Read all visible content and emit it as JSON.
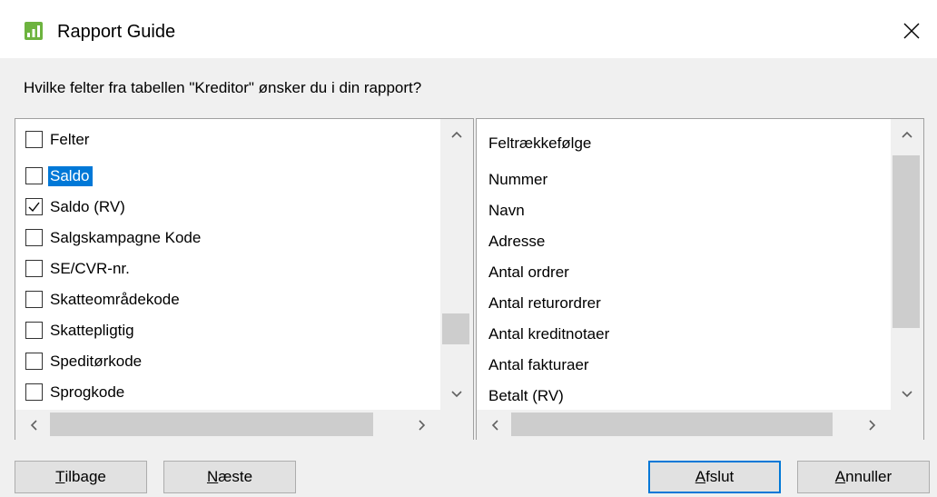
{
  "window": {
    "title": "Rapport Guide",
    "icon": "bar-chart-icon"
  },
  "question": "Hvilke felter fra tabellen \"Kreditor\" ønsker du i din rapport?",
  "left_list": {
    "header": "Felter",
    "items": [
      {
        "label": "Saldo",
        "checked": false,
        "selected": true
      },
      {
        "label": "Saldo (RV)",
        "checked": true,
        "selected": false
      },
      {
        "label": "Salgskampagne Kode",
        "checked": false,
        "selected": false
      },
      {
        "label": "SE/CVR-nr.",
        "checked": false,
        "selected": false
      },
      {
        "label": "Skatteområdekode",
        "checked": false,
        "selected": false
      },
      {
        "label": "Skattepligtig",
        "checked": false,
        "selected": false
      },
      {
        "label": "Speditørkode",
        "checked": false,
        "selected": false
      },
      {
        "label": "Sprogkode",
        "checked": false,
        "selected": false
      }
    ]
  },
  "right_list": {
    "header": "Feltrækkefølge",
    "items": [
      "Nummer",
      "Navn",
      "Adresse",
      "Antal ordrer",
      "Antal returordrer",
      "Antal kreditnotaer",
      "Antal fakturaer",
      "Betalt (RV)"
    ]
  },
  "buttons": {
    "back": {
      "first": "T",
      "rest": "ilbage"
    },
    "next": {
      "first": "N",
      "rest": "æste"
    },
    "finish": {
      "first": "A",
      "rest": "fslut"
    },
    "cancel": {
      "first": "A",
      "rest": "nnuller"
    }
  },
  "colors": {
    "selection": "#0078d7",
    "icon_green": "#6db33f",
    "dialog_bg": "#f0f0f0"
  }
}
